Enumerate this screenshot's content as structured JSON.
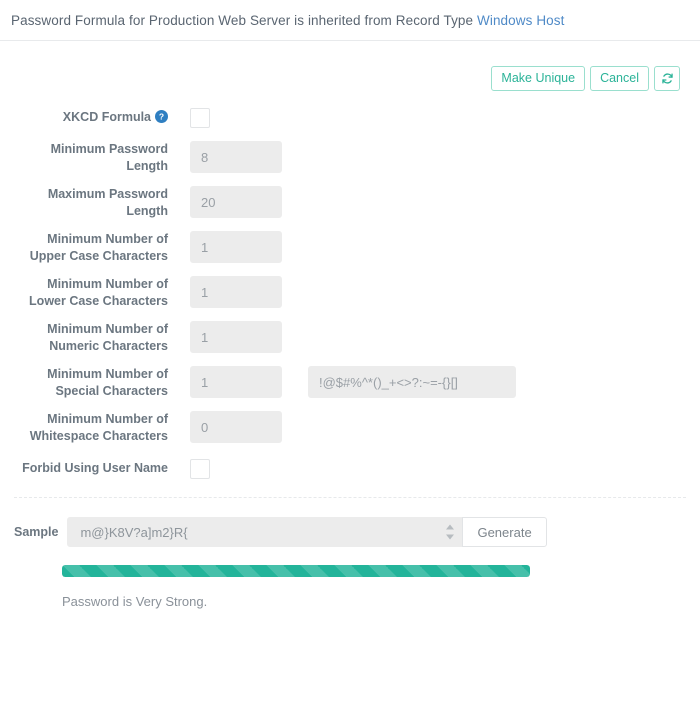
{
  "header": {
    "prefix_text": "Password Formula for Production Web Server is inherited from Record Type ",
    "link_text": "Windows Host"
  },
  "toolbar": {
    "make_unique_label": "Make Unique",
    "cancel_label": "Cancel",
    "refresh_icon": "refresh-icon"
  },
  "form": {
    "xkcd": {
      "label": "XKCD Formula",
      "help_icon": "help-circle-icon",
      "checked": false
    },
    "min_length": {
      "label_line1": "Minimum Password",
      "label_line2": "Length",
      "value": "8"
    },
    "max_length": {
      "label_line1": "Maximum Password",
      "label_line2": "Length",
      "value": "20"
    },
    "min_upper": {
      "label_line1": "Minimum Number of",
      "label_line2": "Upper Case Characters",
      "value": "1"
    },
    "min_lower": {
      "label_line1": "Minimum Number of",
      "label_line2": "Lower Case Characters",
      "value": "1"
    },
    "min_numeric": {
      "label_line1": "Minimum Number of",
      "label_line2": "Numeric Characters",
      "value": "1"
    },
    "min_special": {
      "label_line1": "Minimum Number of",
      "label_line2": "Special Characters",
      "value": "1",
      "charset_value": "!@$#%^*()_+<>?:~=-{}[]"
    },
    "min_whitespace": {
      "label_line1": "Minimum Number of",
      "label_line2": "Whitespace Characters",
      "value": "0"
    },
    "forbid_username": {
      "label": "Forbid Using User Name",
      "checked": false
    }
  },
  "sample": {
    "label": "Sample",
    "value": "m@}K8V?a]m2}R{",
    "generate_label": "Generate",
    "strength_percent": 100,
    "strength_text": "Password is Very Strong."
  },
  "colors": {
    "accent_teal": "#23b49a",
    "link_blue": "#4f8ac7",
    "help_blue": "#2f7fc1",
    "field_gray": "#ececec"
  }
}
